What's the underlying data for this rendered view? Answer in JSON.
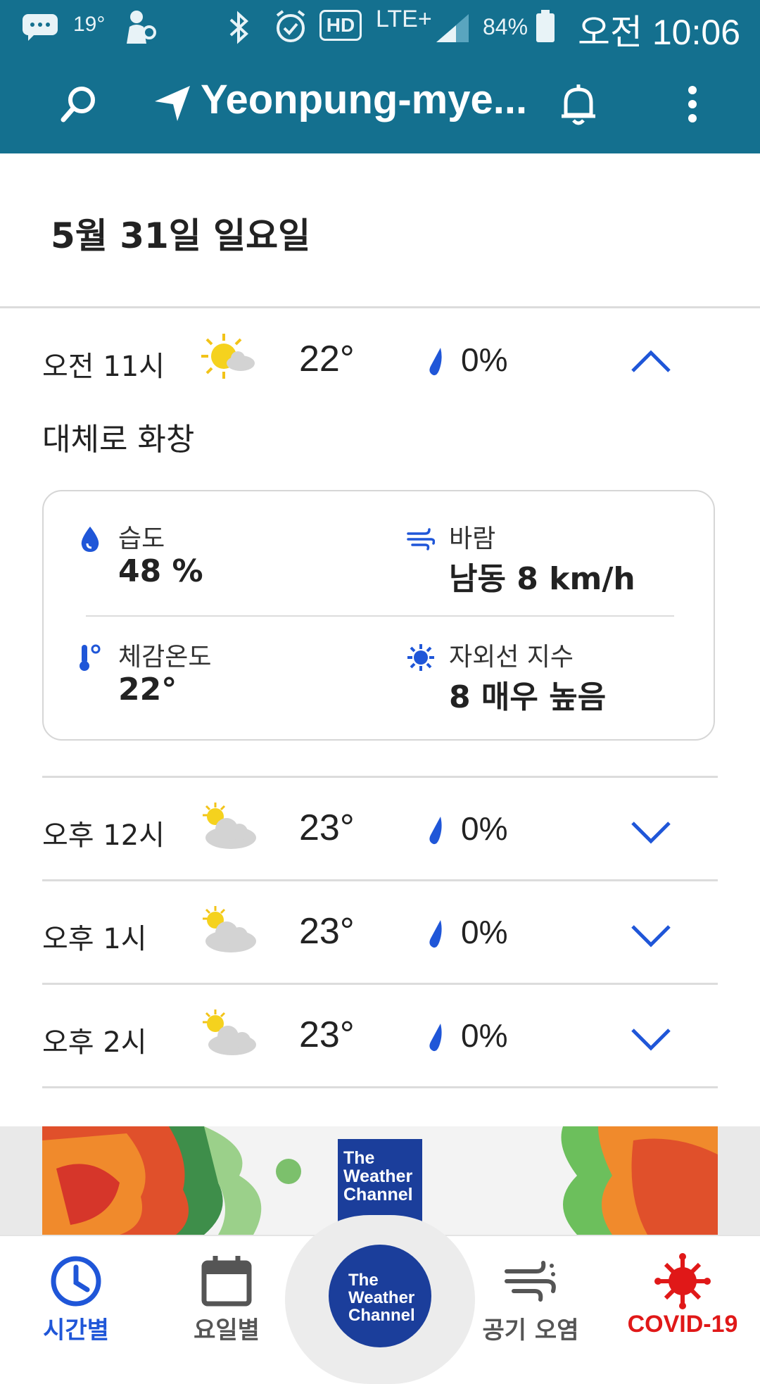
{
  "status_bar": {
    "temp": "19°",
    "network": "LTE+",
    "hd": "HD",
    "battery": "84%",
    "time": "오전 10:06"
  },
  "app_bar": {
    "location": "Yeonpung-mye...",
    "bg_color": "#14708f"
  },
  "date_heading": "5월 31일 일요일",
  "hours": [
    {
      "time": "오전 11시",
      "temp": "22°",
      "precip": "0%",
      "icon": "mostly-sunny-icon",
      "expanded": true
    },
    {
      "time": "오후 12시",
      "temp": "23°",
      "precip": "0%",
      "icon": "partly-cloudy-icon",
      "expanded": false
    },
    {
      "time": "오후 1시",
      "temp": "23°",
      "precip": "0%",
      "icon": "partly-cloudy-icon",
      "expanded": false
    },
    {
      "time": "오후 2시",
      "temp": "23°",
      "precip": "0%",
      "icon": "partly-cloudy-icon",
      "expanded": false
    }
  ],
  "condition": "대체로 화창",
  "details": {
    "humidity": {
      "label": "습도",
      "value": "48 %"
    },
    "wind": {
      "label": "바람",
      "value": "남동 8 km/h"
    },
    "feels_like": {
      "label": "체감온도",
      "value": "22°"
    },
    "uv": {
      "label": "자외선 지수",
      "value": "8 매우 높음"
    }
  },
  "ad": {
    "logo_lines": [
      "The",
      "Weather",
      "Channel"
    ]
  },
  "bottom_nav": {
    "hourly": "시간별",
    "daily": "요일별",
    "center_lines": [
      "The",
      "Weather",
      "Channel"
    ],
    "air": "공기 오염",
    "covid": "COVID-19",
    "active_color": "#1f56d8",
    "covid_color": "#e01818"
  }
}
